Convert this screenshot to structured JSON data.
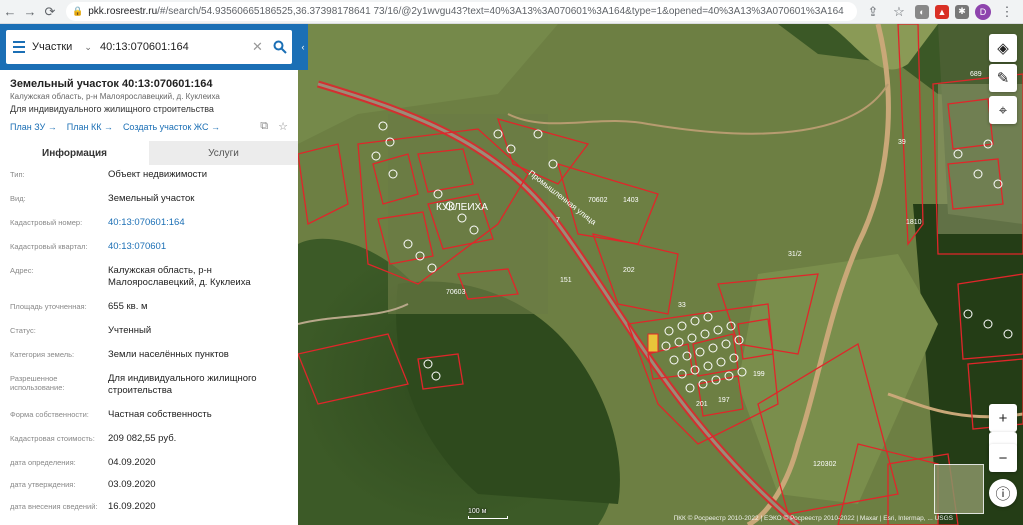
{
  "browser": {
    "url_host": "pkk.rosreestr.ru",
    "url_rest": "/#/search/54.93560665186525,36.37398178641 73/16/@2y1wvgu43?text=40%3A13%3A070601%3A164&type=1&opened=40%3A13%3A070601%3A164",
    "avatar_letter": "D"
  },
  "search": {
    "type_label": "Участки",
    "query": "40:13:070601:164"
  },
  "card": {
    "title": "Земельный участок 40:13:070601:164",
    "subtitle": "Калужская область, р-н Малоярославецкий, д. Куклеиха",
    "purpose": "Для индивидуального жилищного строительства",
    "links": [
      "План ЗУ →",
      "План КК →",
      "Создать участок ЖС →"
    ]
  },
  "tabs": {
    "info": "Информация",
    "services": "Услуги"
  },
  "info_rows": [
    {
      "label": "Тип:",
      "value": "Объект недвижимости"
    },
    {
      "label": "Вид:",
      "value": "Земельный участок"
    },
    {
      "label": "Кадастровый номер:",
      "value": "40:13:070601:164"
    },
    {
      "label": "Кадастровый квартал:",
      "value": "40:13:070601"
    },
    {
      "label": "Адрес:",
      "value": "Калужская область, р-н Малоярославецкий, д. Куклеиха"
    },
    {
      "label": "Площадь уточненная:",
      "value": "655 кв. м"
    },
    {
      "label": "Статус:",
      "value": "Учтенный"
    },
    {
      "label": "Категория земель:",
      "value": "Земли населённых пунктов"
    },
    {
      "label": "Разрешенное использование:",
      "value": "Для индивидуального жилищного строительства"
    },
    {
      "label": "Форма собственности:",
      "value": "Частная собственность"
    },
    {
      "label": "Кадастровая стоимость:",
      "value": "209 082,55 руб."
    },
    {
      "label": "дата определения:",
      "value": "04.09.2020"
    },
    {
      "label": "дата утверждения:",
      "value": "03.09.2020"
    },
    {
      "label": "дата внесения сведений:",
      "value": "16.09.2020"
    }
  ],
  "map": {
    "village_label": "КУКЛЕИХА",
    "road_label": "Промышленная улица",
    "scale_label": "100 м",
    "attribution": "ПКК © Росреестр 2010-2022 | ЕЭКО © Росреестр 2010-2022 | Maxar | Esri, Intermap, ... USGS",
    "parcel_labels": [
      "70602",
      "1403",
      "70603",
      "31/2",
      "120302",
      "33",
      "202",
      "201",
      "197",
      "199",
      "689",
      "7",
      "151",
      "1810",
      "39"
    ]
  }
}
